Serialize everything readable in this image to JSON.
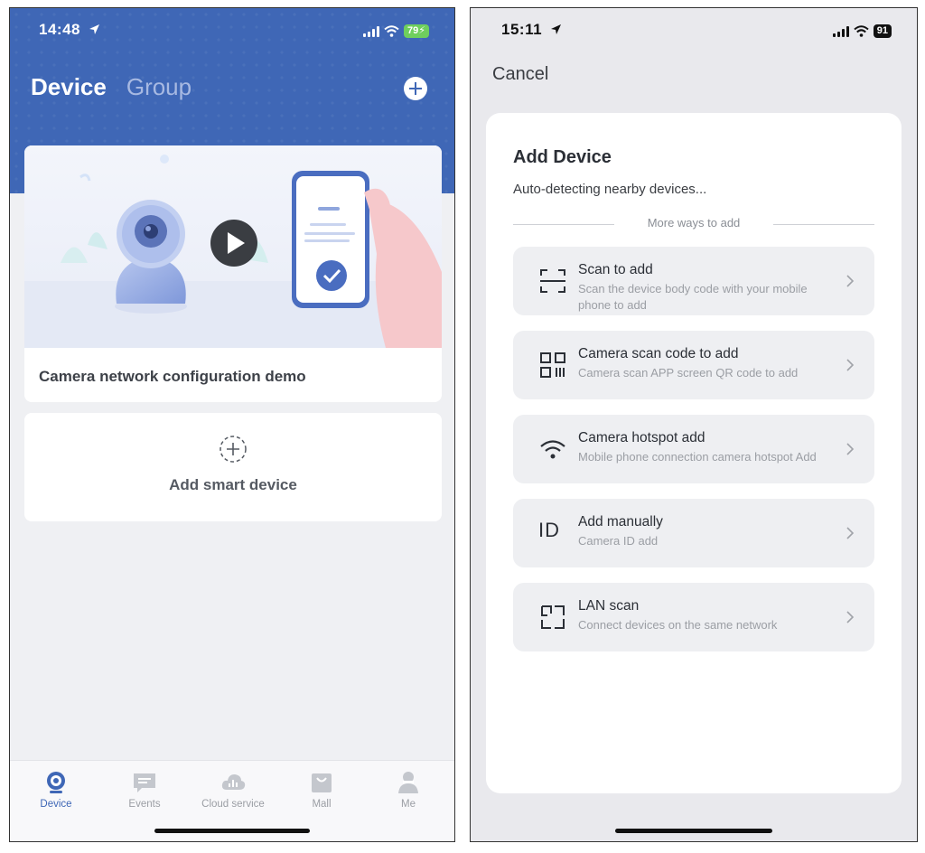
{
  "left": {
    "status": {
      "time": "14:48",
      "battery": "79"
    },
    "header": {
      "tab_device": "Device",
      "tab_group": "Group"
    },
    "demo_card": {
      "title": "Camera network configuration demo"
    },
    "add_card": {
      "label": "Add smart device"
    },
    "tabbar": [
      {
        "label": "Device",
        "icon": "camera-icon",
        "active": true
      },
      {
        "label": "Events",
        "icon": "message-icon",
        "active": false
      },
      {
        "label": "Cloud service",
        "icon": "cloud-icon",
        "active": false
      },
      {
        "label": "Mall",
        "icon": "bag-icon",
        "active": false
      },
      {
        "label": "Me",
        "icon": "user-icon",
        "active": false
      }
    ]
  },
  "right": {
    "status": {
      "time": "15:11",
      "battery": "91"
    },
    "cancel_label": "Cancel",
    "sheet": {
      "title": "Add Device",
      "subtitle": "Auto-detecting nearby devices...",
      "divider_text": "More ways to add",
      "options": [
        {
          "icon": "scan-frame-icon",
          "title": "Scan to add",
          "desc": "Scan the device body code with your mobile phone to add"
        },
        {
          "icon": "qr-code-icon",
          "title": "Camera scan code to add",
          "desc": "Camera scan APP screen QR code to add"
        },
        {
          "icon": "wifi-icon",
          "title": "Camera hotspot add",
          "desc": "Mobile phone connection camera hotspot Add"
        },
        {
          "icon": "id-icon",
          "icon_text": "ID",
          "title": "Add manually",
          "desc": "Camera ID add"
        },
        {
          "icon": "lan-scan-icon",
          "title": "LAN scan",
          "desc": "Connect devices on the same network"
        }
      ]
    }
  },
  "colors": {
    "brand_blue": "#3f67b6",
    "battery_green": "#6fcf5d"
  }
}
